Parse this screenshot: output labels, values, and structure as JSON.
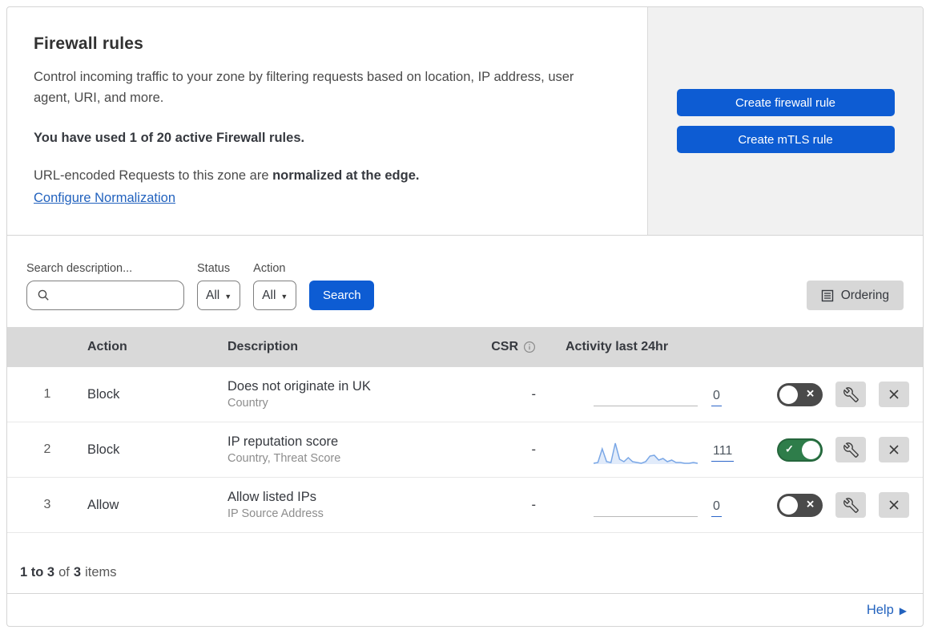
{
  "header": {
    "title": "Firewall rules",
    "description": "Control incoming traffic to your zone by filtering requests based on location, IP address, user agent, URI, and more.",
    "usage": "You have used 1 of 20 active Firewall rules.",
    "normalization_prefix": "URL-encoded Requests to this zone are ",
    "normalization_bold": "normalized at the edge.",
    "normalization_link": "Configure Normalization",
    "buttons": {
      "create_firewall": "Create firewall rule",
      "create_mtls": "Create mTLS rule"
    }
  },
  "filters": {
    "search_label": "Search description...",
    "search_value": "",
    "status_label": "Status",
    "status_value": "All",
    "action_label": "Action",
    "action_value": "All",
    "search_button": "Search",
    "ordering_button": "Ordering"
  },
  "table": {
    "headers": {
      "action": "Action",
      "description": "Description",
      "csr": "CSR",
      "activity": "Activity last 24hr"
    },
    "rows": [
      {
        "num": "1",
        "action": "Block",
        "description": "Does not originate in UK",
        "criteria": "Country",
        "csr": "-",
        "activity_count": "0",
        "enabled": false,
        "has_sparkline": false
      },
      {
        "num": "2",
        "action": "Block",
        "description": "IP reputation score",
        "criteria": "Country, Threat Score",
        "csr": "-",
        "activity_count": "111",
        "enabled": true,
        "has_sparkline": true
      },
      {
        "num": "3",
        "action": "Allow",
        "description": "Allow listed IPs",
        "criteria": "IP Source Address",
        "csr": "-",
        "activity_count": "0",
        "enabled": false,
        "has_sparkline": false
      }
    ]
  },
  "chart_data": {
    "type": "line",
    "title": "Activity last 24hr sparkline (rule 2)",
    "values": [
      1,
      2,
      19,
      3,
      2,
      26,
      6,
      3,
      8,
      3,
      2,
      1,
      3,
      10,
      11,
      5,
      7,
      3,
      5,
      2,
      2,
      1,
      1,
      2,
      1
    ],
    "total": 111,
    "line_color": "#7aa7e6",
    "fill_color": "#e1ebfa"
  },
  "footer": {
    "range": "1 to 3",
    "of": "of",
    "total": "3",
    "items": "items",
    "help": "Help"
  },
  "icons": {
    "toggle_on_glyph": "✓",
    "toggle_off_glyph": "✕",
    "caret_glyph": "▼",
    "help_arrow_glyph": "▶"
  },
  "colors": {
    "button_blue": "#0d5cd3",
    "link_blue": "#2262be",
    "toggle_on_green": "#2e7d4a",
    "toggle_off_gray": "#4a4a4a",
    "table_header_bg": "#d9d9d9",
    "side_panel_bg": "#f1f1f1",
    "sparkline_blue": "#7aa7e6"
  }
}
